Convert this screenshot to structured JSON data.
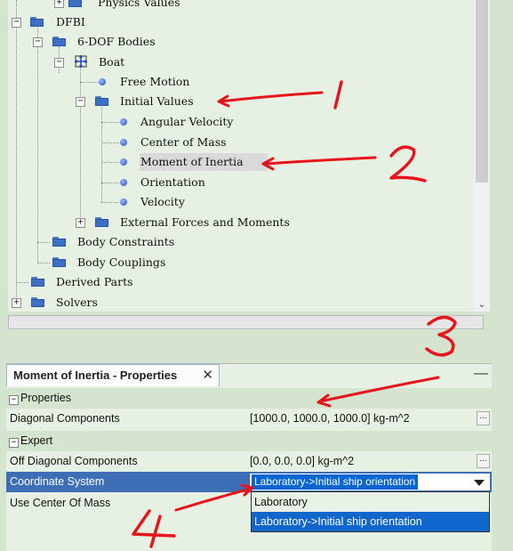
{
  "tree": {
    "items": [
      {
        "label": "Physics Values",
        "icon": "folder-icon"
      },
      {
        "label": "DFBI",
        "icon": "folder-icon"
      },
      {
        "label": "6-DOF Bodies",
        "icon": "folder-icon"
      },
      {
        "label": "Boat",
        "icon": "rigid-body-icon"
      },
      {
        "label": "Free Motion",
        "icon": "dot-icon"
      },
      {
        "label": "Initial Values",
        "icon": "folder-icon"
      },
      {
        "label": "Angular Velocity",
        "icon": "dot-icon"
      },
      {
        "label": "Center of Mass",
        "icon": "dot-icon"
      },
      {
        "label": "Moment of Inertia",
        "icon": "dot-icon"
      },
      {
        "label": "Orientation",
        "icon": "dot-icon"
      },
      {
        "label": "Velocity",
        "icon": "dot-icon"
      },
      {
        "label": "External Forces and Moments",
        "icon": "folder-icon"
      },
      {
        "label": "Body Constraints",
        "icon": "folder-icon"
      },
      {
        "label": "Body Couplings",
        "icon": "folder-icon"
      },
      {
        "label": "Derived Parts",
        "icon": "folder-icon"
      },
      {
        "label": "Solvers",
        "icon": "folder-icon"
      }
    ],
    "selected": "Moment of Inertia"
  },
  "properties_panel": {
    "tab_title": "Moment of Inertia - Properties",
    "close_glyph": "✕",
    "minimize_glyph": "—",
    "sections": [
      {
        "title": "Properties"
      },
      {
        "title": "Expert"
      }
    ],
    "rows": {
      "diagonal": {
        "name": "Diagonal Components",
        "value": "[1000.0, 1000.0, 1000.0] kg-m^2",
        "button": "..."
      },
      "off_diagonal": {
        "name": "Off Diagonal Components",
        "value": "[0.0, 0.0, 0.0] kg-m^2",
        "button": "..."
      },
      "coordinate_system": {
        "name": "Coordinate System",
        "value": "Laboratory->Initial ship orientation"
      },
      "use_center_of_mass": {
        "name": "Use Center Of Mass",
        "value": ""
      }
    },
    "dropdown_options": [
      "Laboratory",
      "Laboratory->Initial ship orientation"
    ],
    "dropdown_active": "Laboratory->Initial ship orientation"
  },
  "annotations": {
    "labels": [
      "1",
      "2",
      "3",
      "4"
    ],
    "color": "#e8141c"
  },
  "colors": {
    "panel_bg": "#e7f1e3",
    "section_bg": "#d5e4cf",
    "selection": "#3e6fb6",
    "dropdown_highlight": "#1166cc"
  }
}
